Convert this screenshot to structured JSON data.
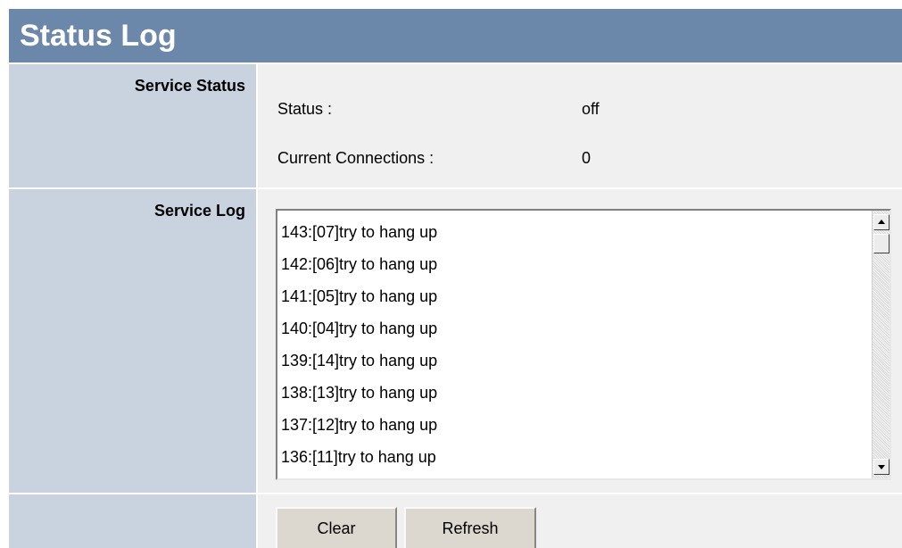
{
  "page": {
    "title": "Status Log"
  },
  "service_status": {
    "section_label": "Service Status",
    "status_label": "Status :",
    "status_value": "off",
    "connections_label": "Current Connections :",
    "connections_value": "0"
  },
  "service_log": {
    "section_label": "Service Log",
    "lines": [
      "143:[07]try to hang up",
      "142:[06]try to hang up",
      "141:[05]try to hang up",
      "140:[04]try to hang up",
      "139:[14]try to hang up",
      "138:[13]try to hang up",
      "137:[12]try to hang up",
      "136:[11]try to hang up"
    ]
  },
  "actions": {
    "clear_label": "Clear",
    "refresh_label": "Refresh"
  },
  "colors": {
    "title_bar": "#6b88aa",
    "label_column": "#c9d2df",
    "content_column": "#f0f0f0"
  }
}
